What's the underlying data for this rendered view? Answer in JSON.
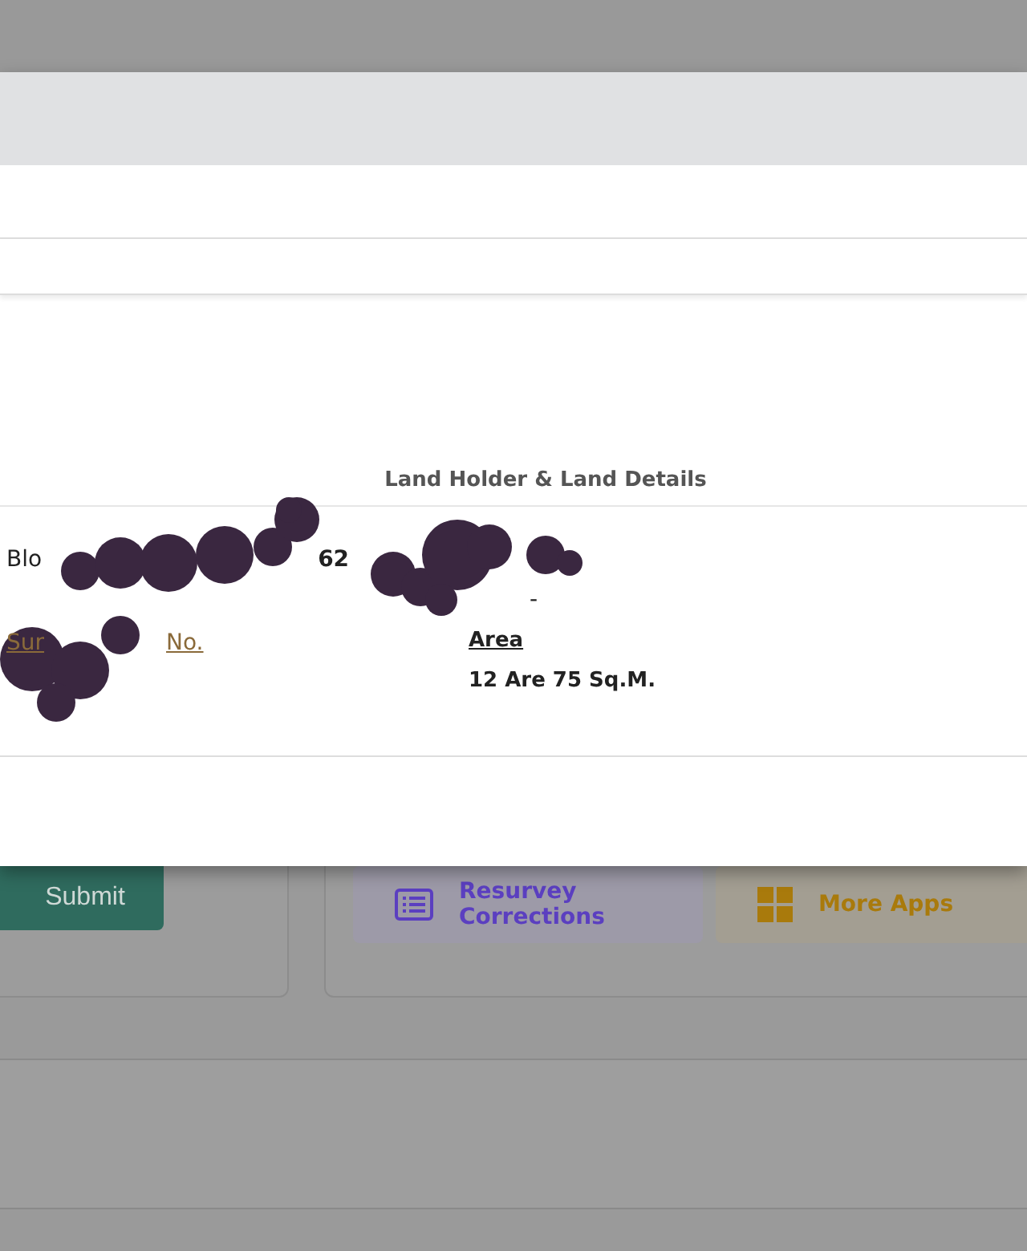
{
  "section_title": "Land Holder & Land Details",
  "details": {
    "line_1": [
      "Blo",
      "62"
    ],
    "line_2": [
      "-"
    ],
    "survey_label": [
      "Sur",
      "No."
    ],
    "area_label": "Area",
    "area_value": "12 Are 75 Sq.M."
  },
  "background": {
    "submit_button": "Submit",
    "apps": [
      {
        "label": "Resurvey Corrections",
        "kind": "list",
        "color": "#5b3fc0"
      },
      {
        "label": "More Apps",
        "kind": "grid",
        "color": "#a97a0c"
      }
    ]
  }
}
